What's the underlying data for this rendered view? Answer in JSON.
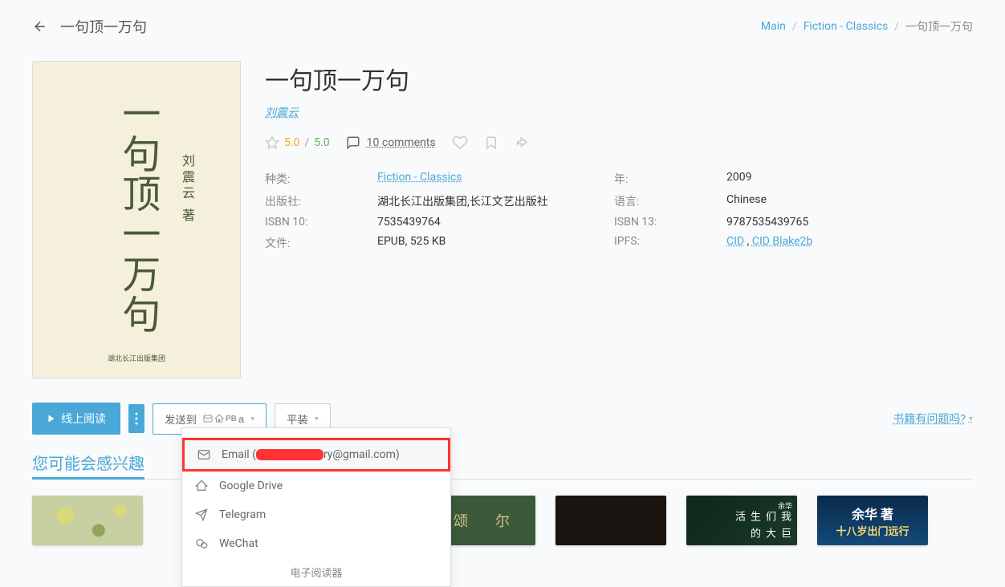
{
  "header": {
    "title": "一句顶一万句",
    "breadcrumb": {
      "main": "Main",
      "category": "Fiction - Classics",
      "current": "一句顶一万句"
    }
  },
  "book": {
    "title": "一句顶一万句",
    "author": "刘震云",
    "cover_author": "刘震云 著",
    "cover_publisher": "湖北长江出版集团",
    "rating_user": "5.0",
    "rating_sep": "/",
    "rating_global": "5.0",
    "comments_label": "10 comments",
    "props": {
      "category_label": "种类:",
      "category_value": "Fiction - Classics",
      "year_label": "年:",
      "year_value": "2009",
      "publisher_label": "出版社:",
      "publisher_value": "湖北长江出版集团,长江文艺出版社",
      "language_label": "语言:",
      "language_value": "Chinese",
      "isbn10_label": "ISBN 10:",
      "isbn10_value": "7535439764",
      "isbn13_label": "ISBN 13:",
      "isbn13_value": "9787535439765",
      "file_label": "文件:",
      "file_value": "EPUB, 525 KB",
      "ipfs_label": "IPFS:",
      "ipfs_cid": "CID",
      "ipfs_sep": ",",
      "ipfs_blake": "CID Blake2b"
    }
  },
  "actions": {
    "read_online": "线上阅读",
    "send_to": "发送到",
    "binding": "平装",
    "report": "书籍有问题吗?"
  },
  "dropdown": {
    "email_label": "Email (",
    "email_suffix": "ry@gmail.com)",
    "gdrive": "Google Drive",
    "telegram": "Telegram",
    "wechat": "WeChat",
    "ereader_header": "电子阅读器"
  },
  "recommendations": {
    "title": "您可能会感兴趣",
    "cards": [
      {
        "bg": "#c8cfa0"
      },
      {
        "bg": "#3a5a3a",
        "top": "颂",
        "bottom": "尔"
      },
      {
        "bg": "#1a1510"
      },
      {
        "bg": "#0d2818",
        "side1": "我们生活",
        "side2": "巨大的",
        "auth": "余华"
      },
      {
        "bg": "#0b2a4a",
        "main": "十八岁出门远行",
        "auth": "余华 著"
      }
    ]
  }
}
